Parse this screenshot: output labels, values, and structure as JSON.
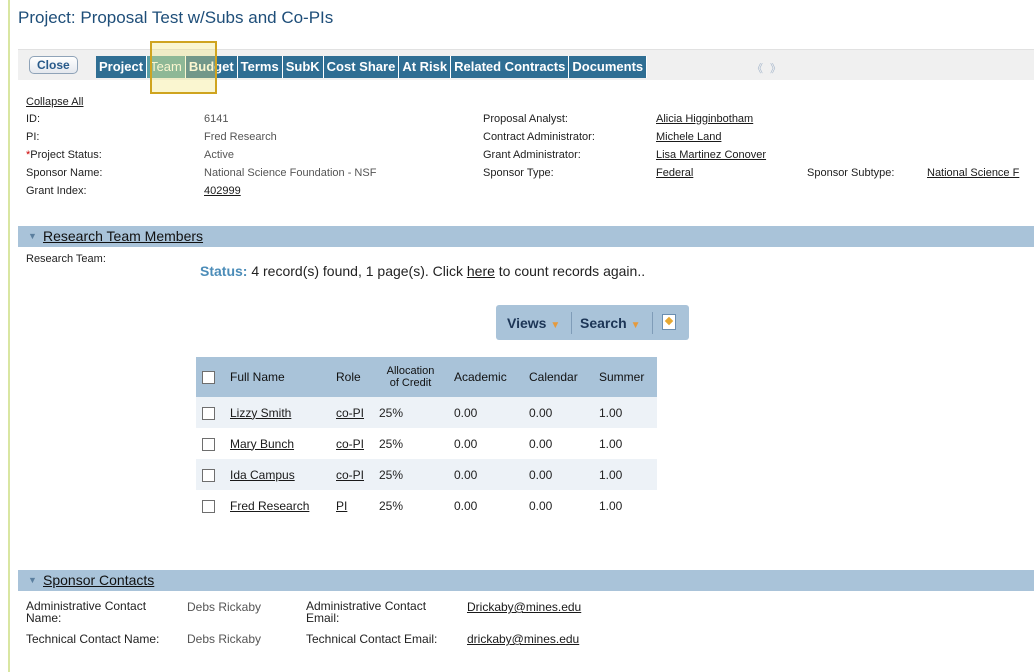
{
  "page": {
    "title": "Project: Proposal Test w/Subs and Co-PIs"
  },
  "toolbar": {
    "close_label": "Close",
    "tabs": [
      "Project",
      "Team",
      "Budget",
      "Terms",
      "SubK",
      "Cost Share",
      "At Risk",
      "Related Contracts",
      "Documents"
    ],
    "active_tab": "Team",
    "arrows": "《 》"
  },
  "info": {
    "collapse_all": "Collapse All",
    "id_label": "ID:",
    "id_value": "6141",
    "pi_label": "PI:",
    "pi_value": "Fred Research",
    "status_required": "*",
    "status_label": "Project Status:",
    "status_value": "Active",
    "sponsor_name_label": "Sponsor Name:",
    "sponsor_name_value": "National Science Foundation - NSF",
    "grant_index_label": "Grant Index:",
    "grant_index_value": "402999",
    "analyst_label": "Proposal Analyst:",
    "analyst_value": "Alicia Higginbotham",
    "contract_admin_label": "Contract Administrator:",
    "contract_admin_value": "Michele Land",
    "grant_admin_label": "Grant Administrator:",
    "grant_admin_value": "Lisa Martinez Conover",
    "sponsor_type_label": "Sponsor Type:",
    "sponsor_type_value": "Federal",
    "sponsor_subtype_label": "Sponsor Subtype:",
    "sponsor_subtype_value": "National Science F"
  },
  "team_section": {
    "title": "Research Team Members",
    "field_label": "Research Team:",
    "status_label": "Status:",
    "status_text": " 4 record(s) found, 1 page(s). Click ",
    "status_link": "here",
    "status_tail": " to count records again..",
    "views_label": "Views",
    "search_label": "Search",
    "columns": [
      "Full Name",
      "Role",
      "Allocation",
      "of Credit",
      "Academic",
      "Calendar",
      "Summer"
    ],
    "rows": [
      {
        "name": "Lizzy Smith",
        "role": "co-PI",
        "alloc": "25%",
        "academic": "0.00",
        "calendar": "0.00",
        "summer": "1.00"
      },
      {
        "name": "Mary Bunch",
        "role": "co-PI",
        "alloc": "25%",
        "academic": "0.00",
        "calendar": "0.00",
        "summer": "1.00"
      },
      {
        "name": "Ida Campus",
        "role": "co-PI",
        "alloc": "25%",
        "academic": "0.00",
        "calendar": "0.00",
        "summer": "1.00"
      },
      {
        "name": "Fred Research",
        "role": "PI",
        "alloc": "25%",
        "academic": "0.00",
        "calendar": "0.00",
        "summer": "1.00"
      }
    ]
  },
  "contacts_section": {
    "title": "Sponsor Contacts",
    "admin_name_label_1": "Administrative Contact",
    "admin_name_label_2": "Name:",
    "admin_name_value": "Debs Rickaby",
    "admin_email_label_1": "Administrative Contact",
    "admin_email_label_2": "Email:",
    "admin_email_value": "Drickaby@mines.edu",
    "tech_name_label": "Technical Contact Name:",
    "tech_name_value": "Debs Rickaby",
    "tech_email_label": "Technical Contact Email:",
    "tech_email_value": "drickaby@mines.edu"
  }
}
